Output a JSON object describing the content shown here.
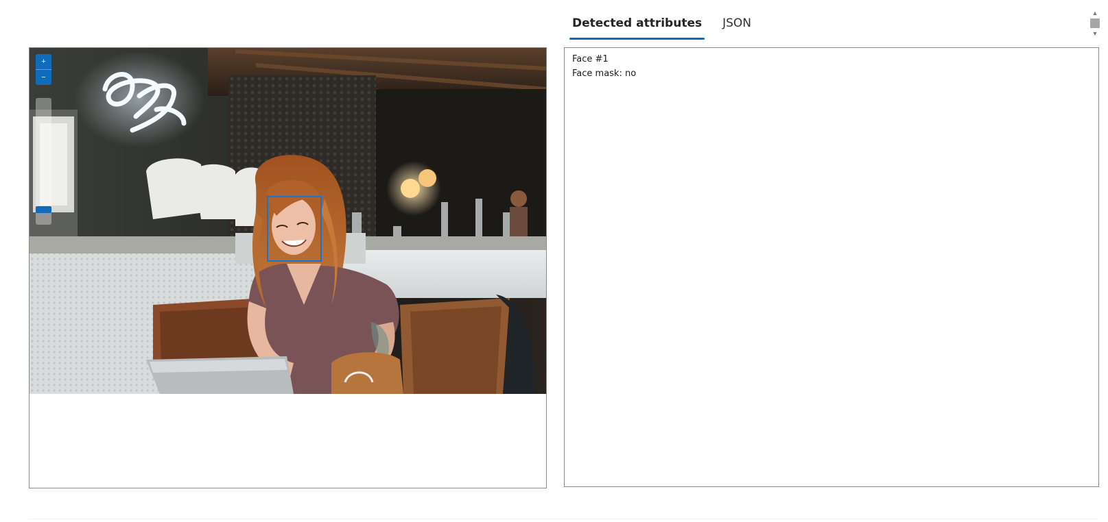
{
  "tabs": {
    "detected_attributes": "Detected attributes",
    "json": "JSON",
    "active": "detected_attributes"
  },
  "viewer": {
    "zoom_in_icon": "plus-icon",
    "zoom_out_icon": "minus-icon",
    "zoom_level": 0.9,
    "photo_description_icon": "photo-woman-laptop-cafe",
    "face_box_color": "#1a73d1"
  },
  "results": {
    "lines": [
      "Face #1",
      "Face mask: no"
    ]
  },
  "colors": {
    "accent": "#0f6cbd",
    "border": "#8a8a8a"
  }
}
